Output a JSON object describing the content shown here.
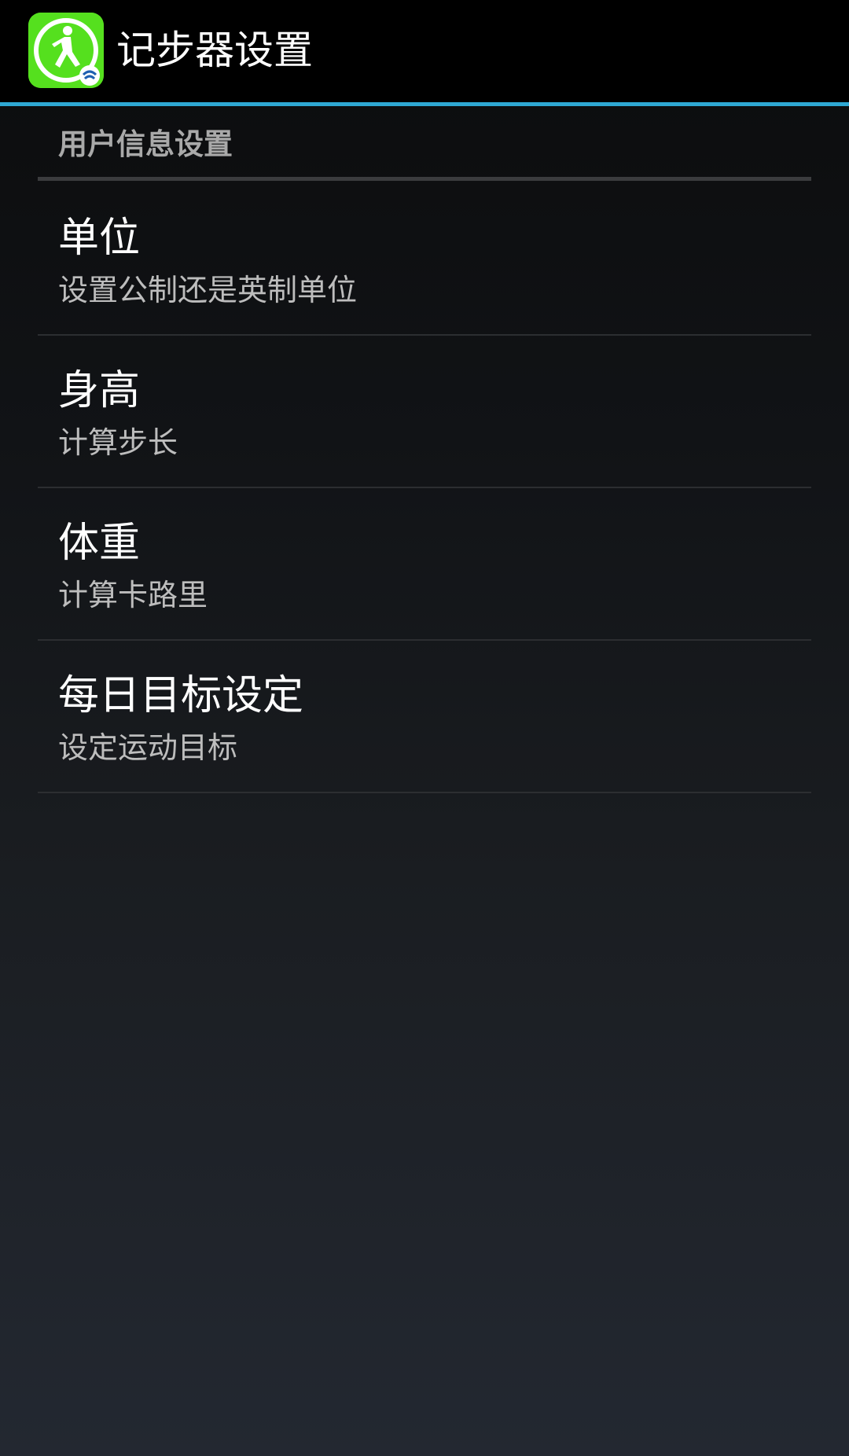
{
  "action_bar": {
    "title": "记步器设置",
    "icon": "running-man-icon",
    "accent_color": "#2ea8d3",
    "icon_color": "#55e01e"
  },
  "section": {
    "header": "用户信息设置"
  },
  "preferences": [
    {
      "title": "单位",
      "summary": "设置公制还是英制单位"
    },
    {
      "title": "身高",
      "summary": "计算步长"
    },
    {
      "title": "体重",
      "summary": "计算卡路里"
    },
    {
      "title": "每日目标设定",
      "summary": "设定运动目标"
    }
  ]
}
